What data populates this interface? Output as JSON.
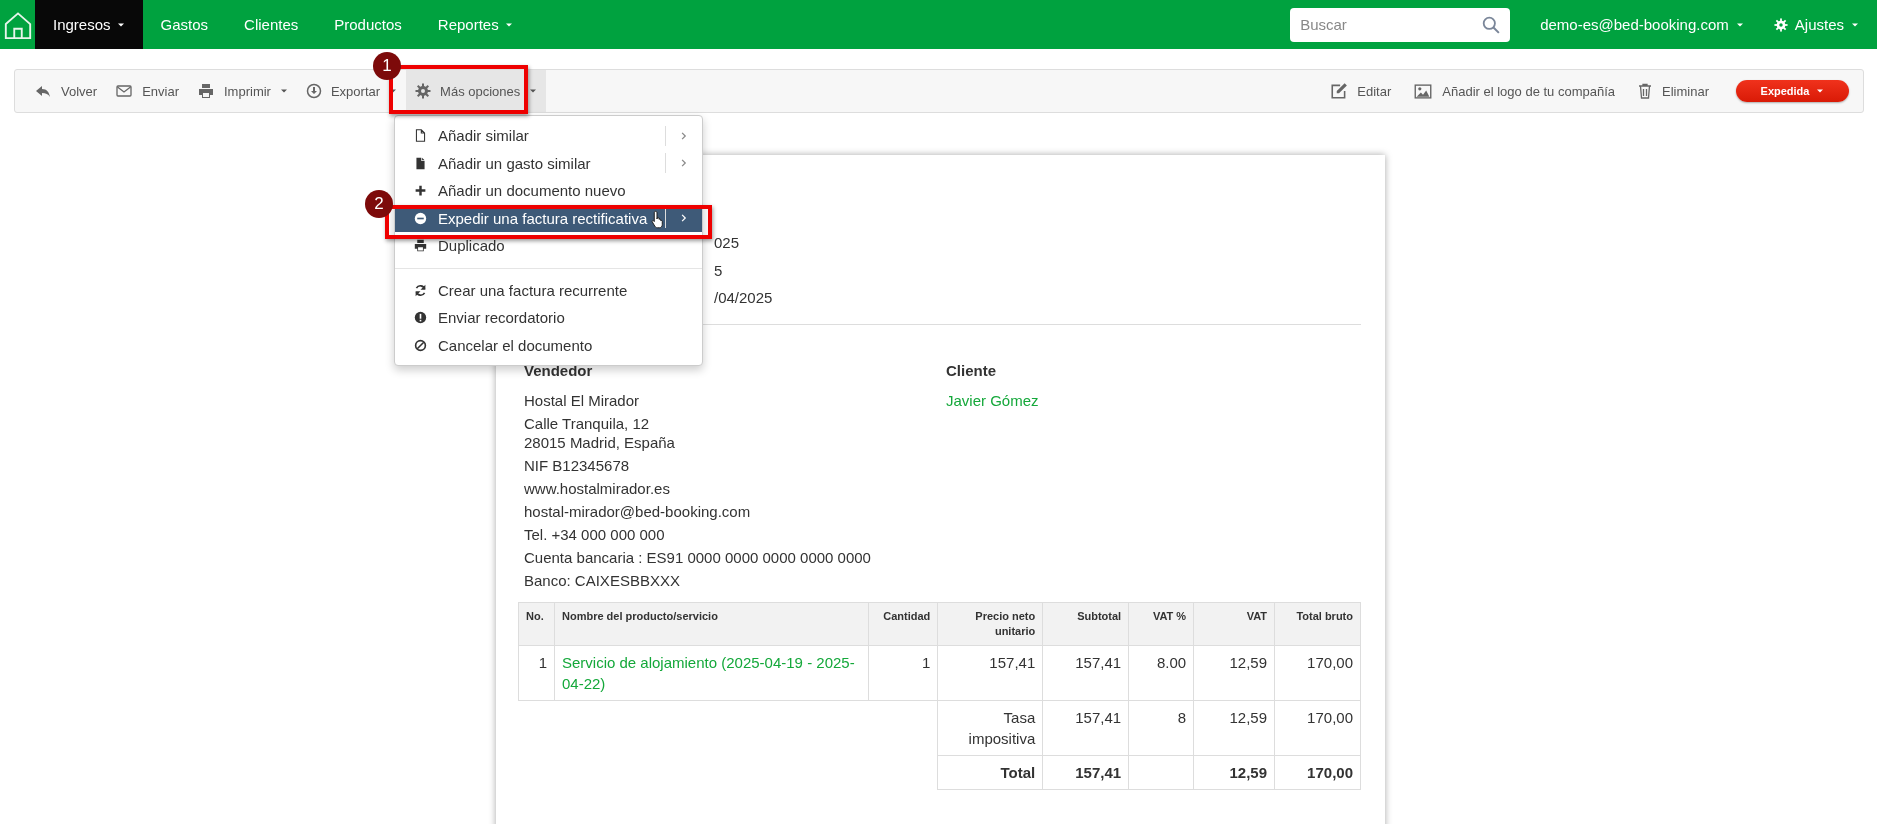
{
  "navbar": {
    "items": [
      {
        "label": "Ingresos",
        "selected": true,
        "dropdown": true
      },
      {
        "label": "Gastos",
        "selected": false,
        "dropdown": false
      },
      {
        "label": "Clientes",
        "selected": false,
        "dropdown": false
      },
      {
        "label": "Productos",
        "selected": false,
        "dropdown": false
      },
      {
        "label": "Reportes",
        "selected": false,
        "dropdown": true
      }
    ],
    "search": {
      "placeholder": "Buscar"
    },
    "account": "demo-es@bed-booking.com",
    "settings": "Ajustes"
  },
  "toolbar": {
    "left": [
      {
        "label": "Volver",
        "dropdown": false,
        "selected": false
      },
      {
        "label": "Enviar",
        "dropdown": false,
        "selected": false
      },
      {
        "label": "Imprimir",
        "dropdown": true,
        "selected": false
      },
      {
        "label": "Exportar",
        "dropdown": true,
        "selected": false
      },
      {
        "label": "Más opciones",
        "dropdown": true,
        "selected": true
      }
    ],
    "right": [
      "Editar",
      "Añadir el logo de tu compañía",
      "Eliminar"
    ],
    "status": "Expedida"
  },
  "menu": {
    "groups": [
      [
        {
          "label": "Añadir similar",
          "submenu": true,
          "selected": false
        },
        {
          "label": "Añadir un gasto similar",
          "submenu": true,
          "selected": false
        },
        {
          "label": "Añadir un documento nuevo",
          "submenu": false,
          "selected": false
        },
        {
          "label": "Expedir una factura rectificativa",
          "submenu": true,
          "selected": true
        },
        {
          "label": "Duplicado",
          "submenu": false,
          "selected": false
        }
      ],
      [
        {
          "label": "Crear una factura recurrente",
          "submenu": false,
          "selected": false
        },
        {
          "label": "Enviar recordatorio",
          "submenu": false,
          "selected": false
        },
        {
          "label": "Cancelar el documento",
          "submenu": false,
          "selected": false
        }
      ]
    ]
  },
  "annotations": [
    {
      "number": "1"
    },
    {
      "number": "2"
    }
  ],
  "document": {
    "header_fragments": [
      "025",
      "5",
      "/04/2025"
    ],
    "seller": {
      "heading": "Vendedor",
      "blocks": [
        [
          "Hostal El Mirador"
        ],
        [
          "Calle Tranquila, 12",
          "28015 Madrid, España"
        ],
        [
          "NIF B12345678"
        ],
        [
          "www.hostalmirador.es"
        ],
        [
          "hostal-mirador@bed-booking.com"
        ],
        [
          "Tel. +34 000 000 000"
        ],
        [
          "Cuenta bancaria : ES91 0000 0000 0000 0000 0000"
        ],
        [
          "Banco: CAIXESBBXXX"
        ]
      ]
    },
    "client": {
      "heading": "Cliente",
      "name": "Javier Gómez"
    },
    "table": {
      "columns": [
        "No.",
        "Nombre del producto/servicio",
        "Cantidad",
        "Precio neto unitario",
        "Subtotal",
        "VAT %",
        "VAT",
        "Total bruto"
      ],
      "rows": [
        {
          "cells": [
            "1",
            "Servicio de alojamiento (2025-04-19 - 2025-04-22)",
            "1",
            "157,41",
            "157,41",
            "8.00",
            "12,59",
            "170,00"
          ]
        }
      ],
      "summary": [
        {
          "kind": "rate",
          "label": "Tasa impositiva",
          "subtotal": "157,41",
          "vat_rate": "8",
          "vat": "12,59",
          "total": "170,00"
        },
        {
          "kind": "total",
          "label": "Total",
          "subtotal": "157,41",
          "vat": "12,59",
          "total": "170,00"
        }
      ]
    }
  }
}
